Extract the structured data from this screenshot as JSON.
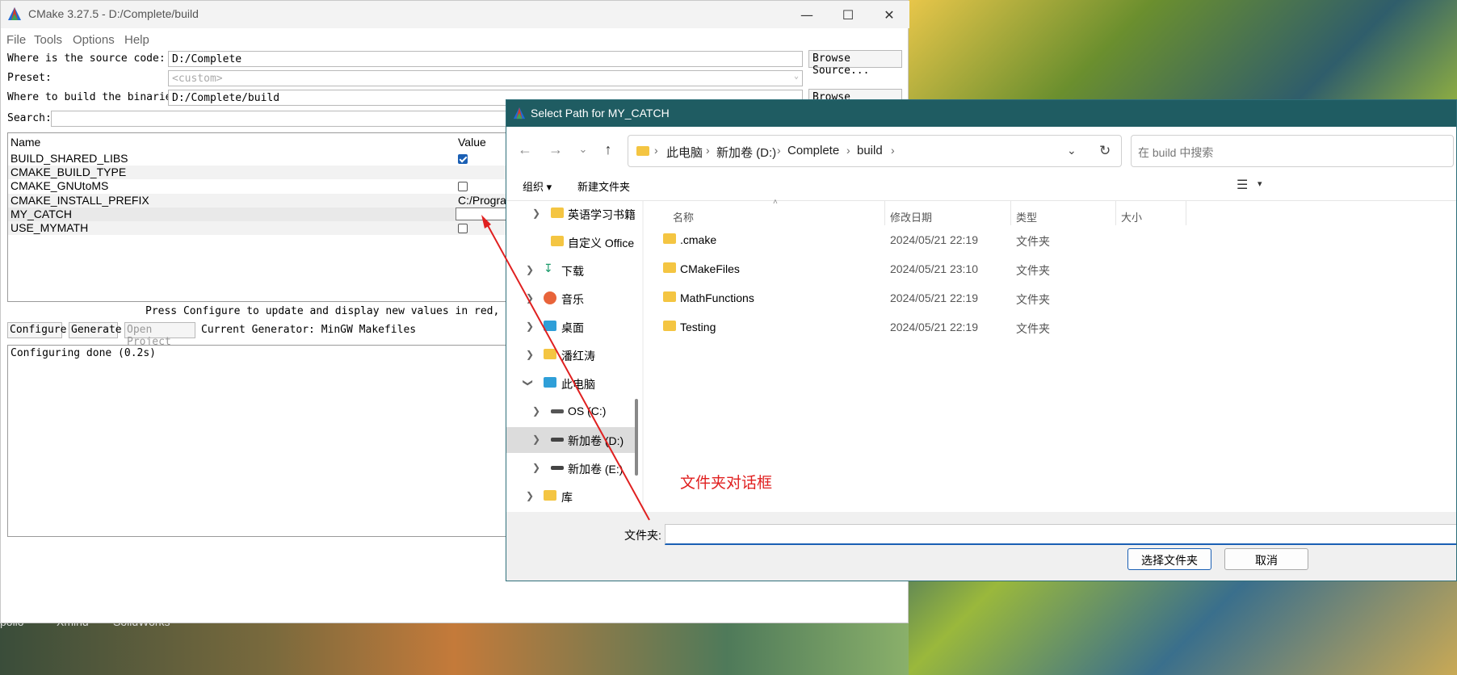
{
  "cmake": {
    "title": "CMake 3.27.5 - D:/Complete/build",
    "menu": [
      "File",
      "Tools",
      "Options",
      "Help"
    ],
    "source_label": "Where is the source code:",
    "source_value": "D:/Complete",
    "browse_source": "Browse Source...",
    "preset_label": "Preset:",
    "preset_value": "<custom>",
    "build_label": "Where to build the binaries:",
    "build_value": "D:/Complete/build",
    "browse_build": "Browse Build...",
    "search_label": "Search:",
    "search_value": "",
    "table_headers": {
      "name": "Name",
      "value": "Value"
    },
    "entries": [
      {
        "name": "BUILD_SHARED_LIBS",
        "type": "checkbox",
        "checked": true
      },
      {
        "name": "CMAKE_BUILD_TYPE",
        "type": "text",
        "value": ""
      },
      {
        "name": "CMAKE_GNUtoMS",
        "type": "checkbox",
        "checked": false
      },
      {
        "name": "CMAKE_INSTALL_PREFIX",
        "type": "text",
        "value": "C:/Progra"
      },
      {
        "name": "MY_CATCH",
        "type": "edit",
        "value": ""
      },
      {
        "name": "USE_MYMATH",
        "type": "checkbox",
        "checked": false
      }
    ],
    "hint": "Press Configure to update and display new values in red, then pr",
    "configure": "Configure",
    "generate": "Generate",
    "open_project": "Open Project",
    "generator": "Current Generator: MinGW Makefiles",
    "output": "Configuring done (0.2s)"
  },
  "dialog": {
    "title": "Select Path for MY_CATCH",
    "breadcrumb": [
      "此电脑",
      "新加卷 (D:)",
      "Complete",
      "build"
    ],
    "search_placeholder": "在 build 中搜索",
    "organize": "组织",
    "new_folder": "新建文件夹",
    "columns": {
      "name": "名称",
      "modified": "修改日期",
      "type": "类型",
      "size": "大小"
    },
    "nav_items": [
      {
        "label": "英语学习书籍",
        "icon": "folder-icon",
        "indent": 2,
        "chevron": true
      },
      {
        "label": "自定义 Office",
        "icon": "folder-icon",
        "indent": 2,
        "chevron": false
      },
      {
        "label": "下载",
        "icon": "download-icon",
        "indent": 1,
        "chevron": true
      },
      {
        "label": "音乐",
        "icon": "music-icon",
        "indent": 1,
        "chevron": true
      },
      {
        "label": "桌面",
        "icon": "desktop-icon",
        "indent": 1,
        "chevron": true
      },
      {
        "label": "潘红涛",
        "icon": "folder-icon",
        "indent": 1,
        "chevron": true
      },
      {
        "label": "此电脑",
        "icon": "computer-icon",
        "indent": 1,
        "chevron": true,
        "expanded": true
      },
      {
        "label": "OS (C:)",
        "icon": "windows-drive-icon",
        "indent": 2,
        "chevron": true
      },
      {
        "label": "新加卷 (D:)",
        "icon": "drive-icon",
        "indent": 2,
        "chevron": true,
        "selected": true
      },
      {
        "label": "新加卷 (E:)",
        "icon": "drive-icon",
        "indent": 2,
        "chevron": true
      },
      {
        "label": "库",
        "icon": "library-icon",
        "indent": 1,
        "chevron": true
      }
    ],
    "files": [
      {
        "name": ".cmake",
        "modified": "2024/05/21 22:19",
        "type": "文件夹"
      },
      {
        "name": "CMakeFiles",
        "modified": "2024/05/21 23:10",
        "type": "文件夹"
      },
      {
        "name": "MathFunctions",
        "modified": "2024/05/21 22:19",
        "type": "文件夹"
      },
      {
        "name": "Testing",
        "modified": "2024/05/21 22:19",
        "type": "文件夹"
      }
    ],
    "folder_label": "文件夹:",
    "folder_value": "",
    "select_button": "选择文件夹",
    "cancel_button": "取消"
  },
  "annotation": "文件夹对话框",
  "taskbar_labels": [
    "pollo",
    "Xmind",
    "SolidWorks"
  ],
  "colors": {
    "dialog_title_bg": "#1f5c62",
    "accent": "#1a5fb4",
    "annotation": "#e02020"
  }
}
